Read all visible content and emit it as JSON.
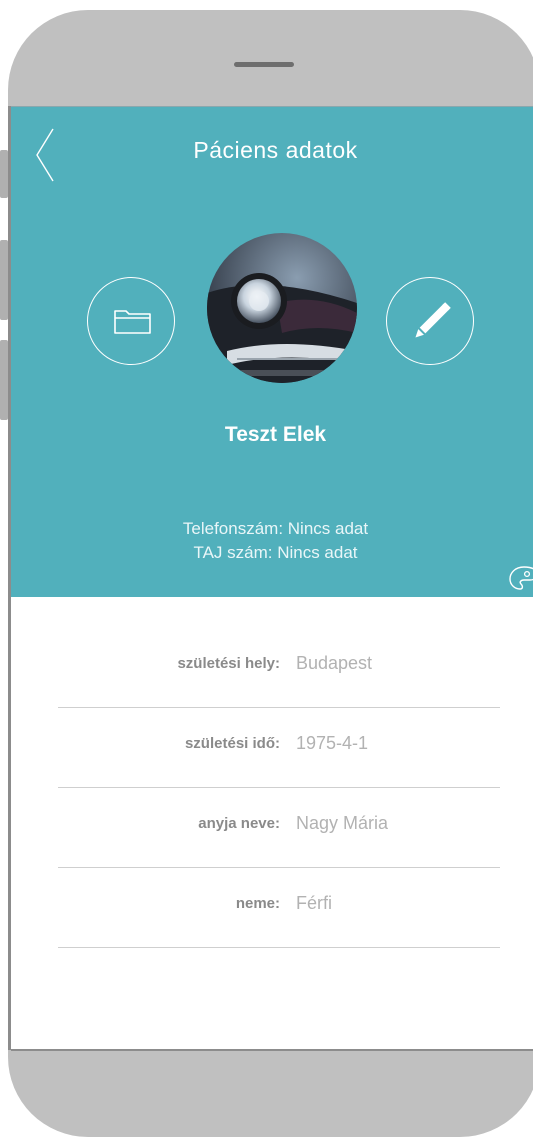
{
  "header": {
    "title": "Páciens adatok",
    "patient_name": "Teszt Elek",
    "phone_line": "Telefonszám: Nincs adat",
    "taj_line": "TAJ szám: Nincs adat"
  },
  "icons": {
    "back": "chevron-left-icon",
    "folder": "folder-icon",
    "edit": "pencil-icon",
    "avatar": "car-photo-avatar",
    "palette": "palette-icon"
  },
  "details": [
    {
      "label": "születési hely:",
      "value": "Budapest"
    },
    {
      "label": "születési idő:",
      "value": "1975-4-1"
    },
    {
      "label": "anyja neve:",
      "value": "Nagy Mária"
    },
    {
      "label": "neme:",
      "value": "Férfi"
    }
  ],
  "colors": {
    "header_bg": "#51b0bc",
    "phone_frame": "#c0c0c0",
    "label_text": "#8a8a8a",
    "value_text": "#b2b2b2"
  }
}
